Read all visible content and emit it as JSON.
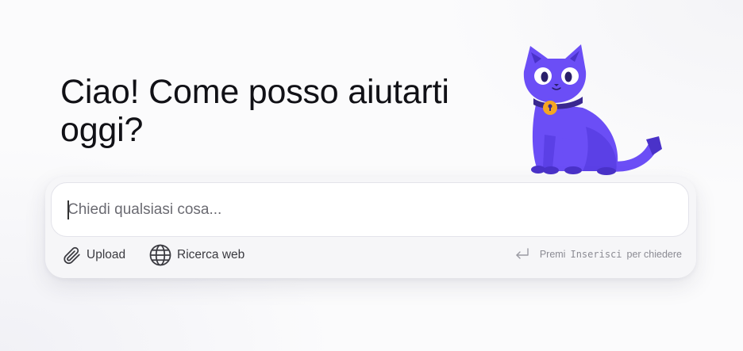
{
  "greeting": {
    "line1": "Ciao! Come posso aiutarti",
    "line2": "oggi?"
  },
  "mascot": {
    "icon": "purple-cat-mascot",
    "colors": {
      "body": "#6b4ef6",
      "shade": "#4a32c9",
      "collar": "#3a2890",
      "bell": "#f5a623"
    }
  },
  "composer": {
    "placeholder": "Chiedi qualsiasi cosa...",
    "value": "",
    "upload_label": "Upload",
    "upload_icon": "paperclip-icon",
    "web_label": "Ricerca web",
    "web_icon": "globe-icon",
    "hint": {
      "icon": "enter-return-icon",
      "prefix": "Premi",
      "key": "Inserisci",
      "suffix": "per chiedere"
    }
  },
  "colors": {
    "accent": "#6b4ef6",
    "text": "#111116",
    "muted": "#8b8b93"
  }
}
